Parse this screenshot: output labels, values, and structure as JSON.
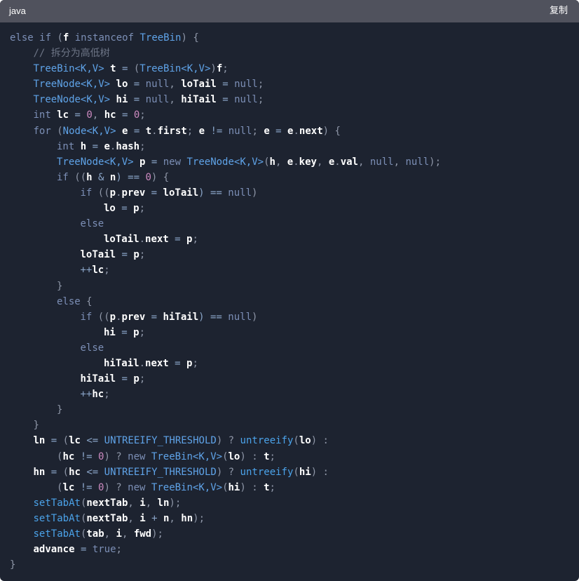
{
  "header": {
    "language": "java",
    "copy_label": "复制"
  },
  "colors": {
    "background": "#1d2330",
    "header": "#50525d",
    "kw": "#7c8fb6",
    "ty": "#5fa3e8",
    "id": "#ffffff",
    "p": "#8f97a8",
    "op": "#8aa5c8",
    "num": "#cc8ac0",
    "fn": "#4ba3ea",
    "cm": "#6d7586",
    "cn": "#5fa3e8"
  },
  "code_lines": [
    {
      "indent": 0,
      "tokens": [
        [
          "else if",
          "kw"
        ],
        [
          " (",
          "p"
        ],
        [
          "f",
          "id"
        ],
        [
          " instanceof ",
          "kw"
        ],
        [
          "TreeBin",
          "ty"
        ],
        [
          ") {",
          "p"
        ]
      ]
    },
    {
      "indent": 1,
      "tokens": [
        [
          "// 拆分为高低树",
          "cm"
        ]
      ]
    },
    {
      "indent": 1,
      "tokens": [
        [
          "TreeBin<K,V>",
          "ty"
        ],
        [
          " ",
          "p"
        ],
        [
          "t",
          "id"
        ],
        [
          " = ",
          "op"
        ],
        [
          "(",
          "p"
        ],
        [
          "TreeBin<K,V>",
          "ty"
        ],
        [
          ")",
          "p"
        ],
        [
          "f",
          "id"
        ],
        [
          ";",
          "p"
        ]
      ]
    },
    {
      "indent": 1,
      "tokens": [
        [
          "TreeNode<K,V>",
          "ty"
        ],
        [
          " ",
          "p"
        ],
        [
          "lo",
          "id"
        ],
        [
          " = ",
          "op"
        ],
        [
          "null",
          "kw"
        ],
        [
          ", ",
          "p"
        ],
        [
          "loTail",
          "id"
        ],
        [
          " = ",
          "op"
        ],
        [
          "null",
          "kw"
        ],
        [
          ";",
          "p"
        ]
      ]
    },
    {
      "indent": 1,
      "tokens": [
        [
          "TreeNode<K,V>",
          "ty"
        ],
        [
          " ",
          "p"
        ],
        [
          "hi",
          "id"
        ],
        [
          " = ",
          "op"
        ],
        [
          "null",
          "kw"
        ],
        [
          ", ",
          "p"
        ],
        [
          "hiTail",
          "id"
        ],
        [
          " = ",
          "op"
        ],
        [
          "null",
          "kw"
        ],
        [
          ";",
          "p"
        ]
      ]
    },
    {
      "indent": 1,
      "tokens": [
        [
          "int",
          "kw"
        ],
        [
          " ",
          "p"
        ],
        [
          "lc",
          "id"
        ],
        [
          " = ",
          "op"
        ],
        [
          "0",
          "num"
        ],
        [
          ", ",
          "p"
        ],
        [
          "hc",
          "id"
        ],
        [
          " = ",
          "op"
        ],
        [
          "0",
          "num"
        ],
        [
          ";",
          "p"
        ]
      ]
    },
    {
      "indent": 1,
      "tokens": [
        [
          "for",
          "kw"
        ],
        [
          " (",
          "p"
        ],
        [
          "Node<K,V>",
          "ty"
        ],
        [
          " ",
          "p"
        ],
        [
          "e",
          "id"
        ],
        [
          " = ",
          "op"
        ],
        [
          "t",
          "id"
        ],
        [
          ".",
          "p"
        ],
        [
          "first",
          "id"
        ],
        [
          "; ",
          "p"
        ],
        [
          "e",
          "id"
        ],
        [
          " != ",
          "op"
        ],
        [
          "null",
          "kw"
        ],
        [
          "; ",
          "p"
        ],
        [
          "e",
          "id"
        ],
        [
          " = ",
          "op"
        ],
        [
          "e",
          "id"
        ],
        [
          ".",
          "p"
        ],
        [
          "next",
          "id"
        ],
        [
          ") {",
          "p"
        ]
      ]
    },
    {
      "indent": 2,
      "tokens": [
        [
          "int",
          "kw"
        ],
        [
          " ",
          "p"
        ],
        [
          "h",
          "id"
        ],
        [
          " = ",
          "op"
        ],
        [
          "e",
          "id"
        ],
        [
          ".",
          "p"
        ],
        [
          "hash",
          "id"
        ],
        [
          ";",
          "p"
        ]
      ]
    },
    {
      "indent": 2,
      "tokens": [
        [
          "TreeNode<K,V>",
          "ty"
        ],
        [
          " ",
          "p"
        ],
        [
          "p",
          "id"
        ],
        [
          " = ",
          "op"
        ],
        [
          "new",
          "kw"
        ],
        [
          " ",
          "p"
        ],
        [
          "TreeNode<K,V>",
          "ty"
        ],
        [
          "(",
          "p"
        ],
        [
          "h",
          "id"
        ],
        [
          ", ",
          "p"
        ],
        [
          "e",
          "id"
        ],
        [
          ".",
          "p"
        ],
        [
          "key",
          "id"
        ],
        [
          ", ",
          "p"
        ],
        [
          "e",
          "id"
        ],
        [
          ".",
          "p"
        ],
        [
          "val",
          "id"
        ],
        [
          ", ",
          "p"
        ],
        [
          "null",
          "kw"
        ],
        [
          ", ",
          "p"
        ],
        [
          "null",
          "kw"
        ],
        [
          ");",
          "p"
        ]
      ]
    },
    {
      "indent": 2,
      "tokens": [
        [
          "if",
          "kw"
        ],
        [
          " ((",
          "p"
        ],
        [
          "h",
          "id"
        ],
        [
          " & ",
          "op"
        ],
        [
          "n",
          "id"
        ],
        [
          ") == ",
          "op"
        ],
        [
          "0",
          "num"
        ],
        [
          ") {",
          "p"
        ]
      ]
    },
    {
      "indent": 3,
      "tokens": [
        [
          "if",
          "kw"
        ],
        [
          " ((",
          "p"
        ],
        [
          "p",
          "id"
        ],
        [
          ".",
          "p"
        ],
        [
          "prev",
          "id"
        ],
        [
          " = ",
          "op"
        ],
        [
          "loTail",
          "id"
        ],
        [
          ") == ",
          "op"
        ],
        [
          "null",
          "kw"
        ],
        [
          ")",
          "p"
        ]
      ]
    },
    {
      "indent": 4,
      "tokens": [
        [
          "lo",
          "id"
        ],
        [
          " = ",
          "op"
        ],
        [
          "p",
          "id"
        ],
        [
          ";",
          "p"
        ]
      ]
    },
    {
      "indent": 3,
      "tokens": [
        [
          "else",
          "kw"
        ]
      ]
    },
    {
      "indent": 4,
      "tokens": [
        [
          "loTail",
          "id"
        ],
        [
          ".",
          "p"
        ],
        [
          "next",
          "id"
        ],
        [
          " = ",
          "op"
        ],
        [
          "p",
          "id"
        ],
        [
          ";",
          "p"
        ]
      ]
    },
    {
      "indent": 3,
      "tokens": [
        [
          "loTail",
          "id"
        ],
        [
          " = ",
          "op"
        ],
        [
          "p",
          "id"
        ],
        [
          ";",
          "p"
        ]
      ]
    },
    {
      "indent": 3,
      "tokens": [
        [
          "++",
          "op"
        ],
        [
          "lc",
          "id"
        ],
        [
          ";",
          "p"
        ]
      ]
    },
    {
      "indent": 2,
      "tokens": [
        [
          "}",
          "p"
        ]
      ]
    },
    {
      "indent": 2,
      "tokens": [
        [
          "else",
          "kw"
        ],
        [
          " {",
          "p"
        ]
      ]
    },
    {
      "indent": 3,
      "tokens": [
        [
          "if",
          "kw"
        ],
        [
          " ((",
          "p"
        ],
        [
          "p",
          "id"
        ],
        [
          ".",
          "p"
        ],
        [
          "prev",
          "id"
        ],
        [
          " = ",
          "op"
        ],
        [
          "hiTail",
          "id"
        ],
        [
          ") == ",
          "op"
        ],
        [
          "null",
          "kw"
        ],
        [
          ")",
          "p"
        ]
      ]
    },
    {
      "indent": 4,
      "tokens": [
        [
          "hi",
          "id"
        ],
        [
          " = ",
          "op"
        ],
        [
          "p",
          "id"
        ],
        [
          ";",
          "p"
        ]
      ]
    },
    {
      "indent": 3,
      "tokens": [
        [
          "else",
          "kw"
        ]
      ]
    },
    {
      "indent": 4,
      "tokens": [
        [
          "hiTail",
          "id"
        ],
        [
          ".",
          "p"
        ],
        [
          "next",
          "id"
        ],
        [
          " = ",
          "op"
        ],
        [
          "p",
          "id"
        ],
        [
          ";",
          "p"
        ]
      ]
    },
    {
      "indent": 3,
      "tokens": [
        [
          "hiTail",
          "id"
        ],
        [
          " = ",
          "op"
        ],
        [
          "p",
          "id"
        ],
        [
          ";",
          "p"
        ]
      ]
    },
    {
      "indent": 3,
      "tokens": [
        [
          "++",
          "op"
        ],
        [
          "hc",
          "id"
        ],
        [
          ";",
          "p"
        ]
      ]
    },
    {
      "indent": 2,
      "tokens": [
        [
          "}",
          "p"
        ]
      ]
    },
    {
      "indent": 1,
      "tokens": [
        [
          "}",
          "p"
        ]
      ]
    },
    {
      "indent": 1,
      "tokens": [
        [
          "ln",
          "id"
        ],
        [
          " = ",
          "op"
        ],
        [
          "(",
          "p"
        ],
        [
          "lc",
          "id"
        ],
        [
          " <= ",
          "op"
        ],
        [
          "UNTREEIFY_THRESHOLD",
          "cn"
        ],
        [
          ") ? ",
          "p"
        ],
        [
          "untreeify",
          "fn"
        ],
        [
          "(",
          "p"
        ],
        [
          "lo",
          "id"
        ],
        [
          ") :",
          "p"
        ]
      ]
    },
    {
      "indent": 2,
      "tokens": [
        [
          "(",
          "p"
        ],
        [
          "hc",
          "id"
        ],
        [
          " != ",
          "op"
        ],
        [
          "0",
          "num"
        ],
        [
          ") ? ",
          "p"
        ],
        [
          "new",
          "kw"
        ],
        [
          " ",
          "p"
        ],
        [
          "TreeBin<K,V>",
          "ty"
        ],
        [
          "(",
          "p"
        ],
        [
          "lo",
          "id"
        ],
        [
          ") : ",
          "p"
        ],
        [
          "t",
          "id"
        ],
        [
          ";",
          "p"
        ]
      ]
    },
    {
      "indent": 1,
      "tokens": [
        [
          "hn",
          "id"
        ],
        [
          " = ",
          "op"
        ],
        [
          "(",
          "p"
        ],
        [
          "hc",
          "id"
        ],
        [
          " <= ",
          "op"
        ],
        [
          "UNTREEIFY_THRESHOLD",
          "cn"
        ],
        [
          ") ? ",
          "p"
        ],
        [
          "untreeify",
          "fn"
        ],
        [
          "(",
          "p"
        ],
        [
          "hi",
          "id"
        ],
        [
          ") :",
          "p"
        ]
      ]
    },
    {
      "indent": 2,
      "tokens": [
        [
          "(",
          "p"
        ],
        [
          "lc",
          "id"
        ],
        [
          " != ",
          "op"
        ],
        [
          "0",
          "num"
        ],
        [
          ") ? ",
          "p"
        ],
        [
          "new",
          "kw"
        ],
        [
          " ",
          "p"
        ],
        [
          "TreeBin<K,V>",
          "ty"
        ],
        [
          "(",
          "p"
        ],
        [
          "hi",
          "id"
        ],
        [
          ") : ",
          "p"
        ],
        [
          "t",
          "id"
        ],
        [
          ";",
          "p"
        ]
      ]
    },
    {
      "indent": 1,
      "tokens": [
        [
          "setTabAt",
          "fn"
        ],
        [
          "(",
          "p"
        ],
        [
          "nextTab",
          "id"
        ],
        [
          ", ",
          "p"
        ],
        [
          "i",
          "id"
        ],
        [
          ", ",
          "p"
        ],
        [
          "ln",
          "id"
        ],
        [
          ");",
          "p"
        ]
      ]
    },
    {
      "indent": 1,
      "tokens": [
        [
          "setTabAt",
          "fn"
        ],
        [
          "(",
          "p"
        ],
        [
          "nextTab",
          "id"
        ],
        [
          ", ",
          "p"
        ],
        [
          "i",
          "id"
        ],
        [
          " + ",
          "op"
        ],
        [
          "n",
          "id"
        ],
        [
          ", ",
          "p"
        ],
        [
          "hn",
          "id"
        ],
        [
          ");",
          "p"
        ]
      ]
    },
    {
      "indent": 1,
      "tokens": [
        [
          "setTabAt",
          "fn"
        ],
        [
          "(",
          "p"
        ],
        [
          "tab",
          "id"
        ],
        [
          ", ",
          "p"
        ],
        [
          "i",
          "id"
        ],
        [
          ", ",
          "p"
        ],
        [
          "fwd",
          "id"
        ],
        [
          ");",
          "p"
        ]
      ]
    },
    {
      "indent": 1,
      "tokens": [
        [
          "advance",
          "id"
        ],
        [
          " = ",
          "op"
        ],
        [
          "true",
          "kw"
        ],
        [
          ";",
          "p"
        ]
      ]
    },
    {
      "indent": 0,
      "tokens": [
        [
          "}",
          "p"
        ]
      ]
    }
  ]
}
